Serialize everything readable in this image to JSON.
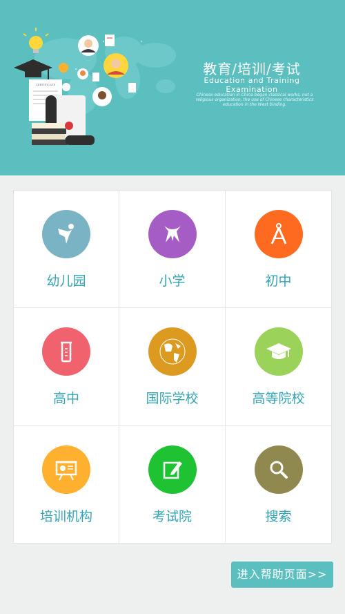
{
  "banner": {
    "title": "教育/培训/考试",
    "subtitle": "Education and Training Examination",
    "description": "Chinese education in China began classical works, not a religious organization, the use of Chinese characteristics education in the West binding.",
    "certificate_text": "CERTIFICATE"
  },
  "categories": [
    {
      "label": "幼儿园",
      "icon": "kindergarten-icon",
      "color": "#7ab3c4"
    },
    {
      "label": "小学",
      "icon": "primary-school-icon",
      "color": "#a55cc4"
    },
    {
      "label": "初中",
      "icon": "compass-icon",
      "color": "#ff6a21"
    },
    {
      "label": "高中",
      "icon": "beaker-icon",
      "color": "#f0636e"
    },
    {
      "label": "国际学校",
      "icon": "globe-icon",
      "color": "#dd9a21"
    },
    {
      "label": "高等院校",
      "icon": "graduation-cap-icon",
      "color": "#9ad25a"
    },
    {
      "label": "培训机构",
      "icon": "presentation-board-icon",
      "color": "#ffb02e"
    },
    {
      "label": "考试院",
      "icon": "edit-icon",
      "color": "#1fc233"
    },
    {
      "label": "搜索",
      "icon": "search-icon",
      "color": "#8f8950"
    }
  ],
  "help_button": {
    "label": "进入帮助页面>>"
  }
}
